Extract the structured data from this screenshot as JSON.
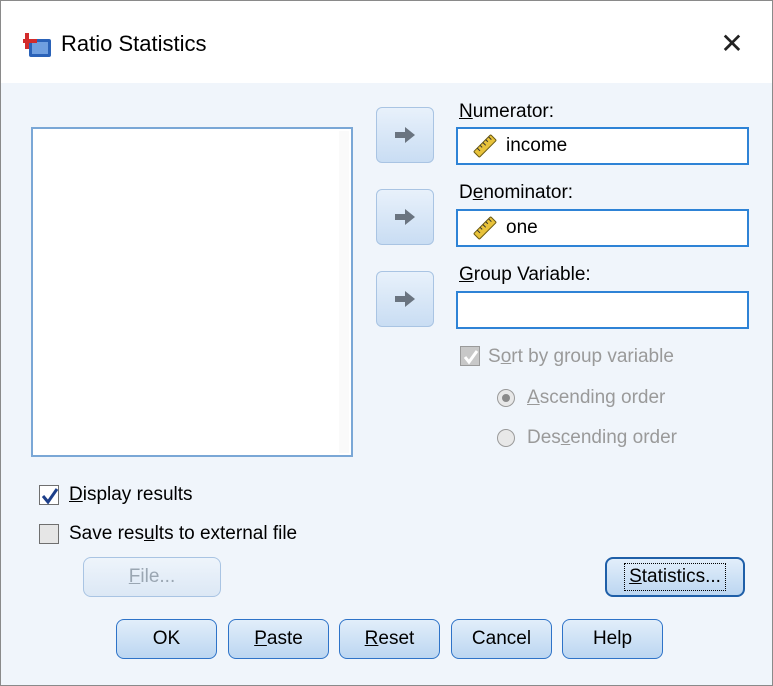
{
  "window": {
    "title": "Ratio Statistics",
    "close_glyph": "✕"
  },
  "targets": {
    "numerator": {
      "label_pre": "",
      "label_key": "N",
      "label_post": "umerator:",
      "value": "income",
      "icon": "scale-ruler-icon"
    },
    "denominator": {
      "label_pre": "D",
      "label_key": "e",
      "label_post": "nominator:",
      "value": "one",
      "icon": "scale-ruler-icon"
    },
    "group": {
      "label_pre": "",
      "label_key": "G",
      "label_post": "roup Variable:",
      "value": ""
    }
  },
  "sort": {
    "label_pre": "S",
    "label_key": "o",
    "label_post": "rt by group variable",
    "checked": true,
    "enabled": false,
    "ascending": {
      "label_pre": "",
      "label_key": "A",
      "label_post": "scending order",
      "selected": true
    },
    "descending": {
      "label_pre": "Des",
      "label_key": "c",
      "label_post": "ending order",
      "selected": false
    }
  },
  "display_results": {
    "label_pre": "",
    "label_key": "D",
    "label_post": "isplay results",
    "checked": true
  },
  "save_results": {
    "label_pre": "Save res",
    "label_key": "u",
    "label_post": "lts to external file",
    "checked": false
  },
  "buttons": {
    "file": {
      "label_pre": "",
      "label_key": "F",
      "label_post": "ile..."
    },
    "statistics": {
      "label_pre": "",
      "label_key": "S",
      "label_post": "tatistics..."
    },
    "ok": {
      "label_pre": "OK",
      "label_key": "",
      "label_post": ""
    },
    "paste": {
      "label_pre": "",
      "label_key": "P",
      "label_post": "aste"
    },
    "reset": {
      "label_pre": "",
      "label_key": "R",
      "label_post": "eset"
    },
    "cancel": {
      "label_pre": "Cancel",
      "label_key": "",
      "label_post": ""
    },
    "help": {
      "label_pre": "Help",
      "label_key": "",
      "label_post": ""
    }
  },
  "colors": {
    "dialog_bg": "#f0f5fb",
    "accent_border": "#2e83d6",
    "checkmark": "#1d3f8a"
  }
}
